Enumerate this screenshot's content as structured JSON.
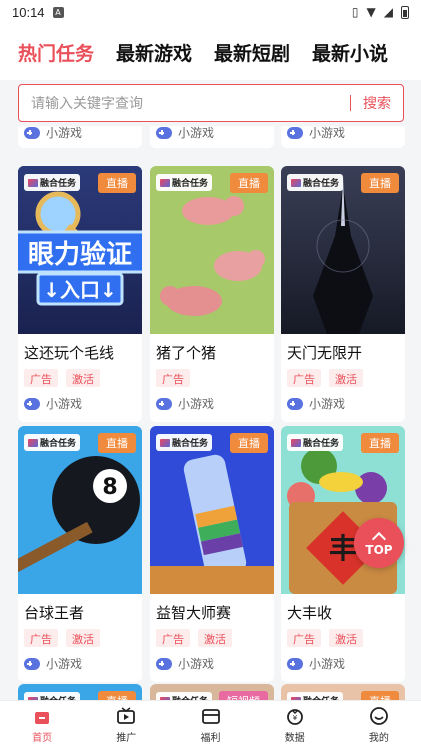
{
  "status": {
    "time": "10:14"
  },
  "tabs": [
    {
      "label": "热门任务",
      "active": true
    },
    {
      "label": "最新游戏",
      "active": false
    },
    {
      "label": "最新短剧",
      "active": false
    },
    {
      "label": "最新小说",
      "active": false
    }
  ],
  "search": {
    "placeholder": "请输入关键字查询",
    "button": "搜索"
  },
  "partial_row": [
    "小游戏",
    "小游戏",
    "小游戏"
  ],
  "badges": {
    "task": "融合任务",
    "live": "直播"
  },
  "cards": [
    {
      "title": "这还玩个毛线",
      "tags": [
        "广告",
        "激活"
      ],
      "category": "小游戏",
      "thumb_text": "眼力验证 入口"
    },
    {
      "title": "猪了个猪",
      "tags": [
        "广告"
      ],
      "category": "小游戏"
    },
    {
      "title": "天门无限开",
      "tags": [
        "广告",
        "激活"
      ],
      "category": "小游戏"
    },
    {
      "title": "台球王者",
      "tags": [
        "广告",
        "激活"
      ],
      "category": "小游戏"
    },
    {
      "title": "益智大师赛",
      "tags": [
        "广告",
        "激活"
      ],
      "category": "小游戏"
    },
    {
      "title": "大丰收",
      "tags": [
        "广告",
        "激活"
      ],
      "category": "小游戏"
    }
  ],
  "bottom_partial_badge": "短视频",
  "top_button": "TOP",
  "bottom_nav": [
    {
      "label": "首页",
      "icon": "home-icon",
      "active": true
    },
    {
      "label": "推广",
      "icon": "tv-icon",
      "active": false
    },
    {
      "label": "福利",
      "icon": "wallet-icon",
      "active": false
    },
    {
      "label": "数据",
      "icon": "data-icon",
      "active": false
    },
    {
      "label": "我的",
      "icon": "profile-icon",
      "active": false
    }
  ],
  "colors": {
    "accent": "#e9505a",
    "live_badge": "#f08a3c",
    "pad_icon": "#5a72e0"
  }
}
